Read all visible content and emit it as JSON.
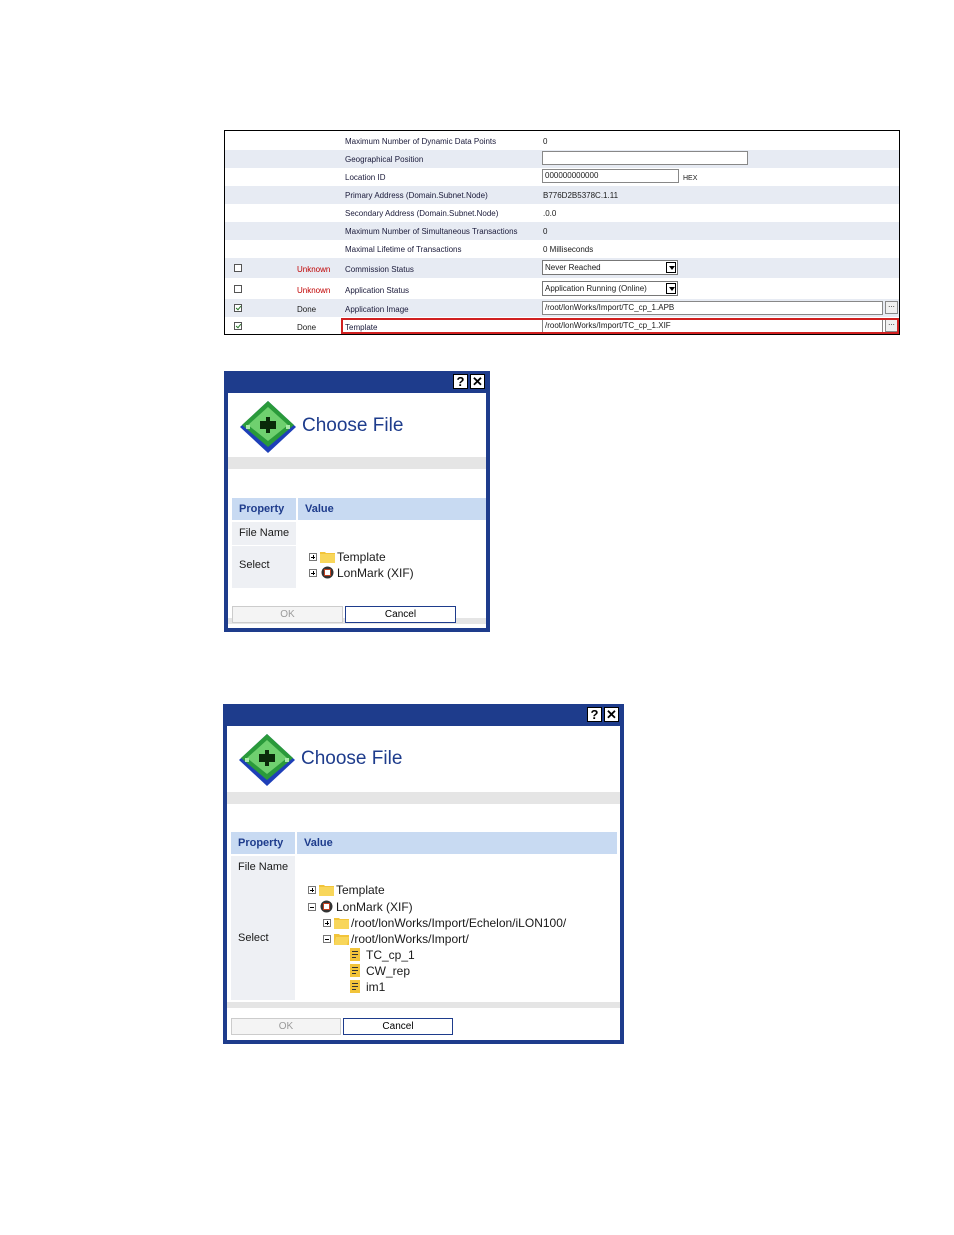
{
  "properties": {
    "rows": [
      {
        "checkbox": null,
        "status": "",
        "name": "Maximum Number of Dynamic Data Points",
        "value": "0"
      },
      {
        "checkbox": null,
        "status": "",
        "name": "Geographical Position",
        "value": ""
      },
      {
        "checkbox": null,
        "status": "",
        "name": "Location ID",
        "value": "000000000000"
      },
      {
        "checkbox": null,
        "status": "",
        "name": "Primary Address (Domain.Subnet.Node)",
        "value": "B776D2B5378C.1.11"
      },
      {
        "checkbox": null,
        "status": "",
        "name": "Secondary Address (Domain.Subnet.Node)",
        "value": ".0.0"
      },
      {
        "checkbox": null,
        "status": "",
        "name": "Maximum Number of Simultaneous Transactions",
        "value": "0"
      },
      {
        "checkbox": null,
        "status": "",
        "name": "Maximal Lifetime of Transactions",
        "value": "0 Milliseconds"
      },
      {
        "checkbox": false,
        "status": "Unknown",
        "name": "Commission Status",
        "value": "Never Reached"
      },
      {
        "checkbox": false,
        "status": "Unknown",
        "name": "Application Status",
        "value": "Application Running (Online)"
      },
      {
        "checkbox": true,
        "status": "Done",
        "name": "Application Image",
        "value": "/root/lonWorks/Import/TC_cp_1.APB"
      },
      {
        "checkbox": true,
        "status": "Done",
        "name": "Template",
        "value": "/root/lonWorks/Import/TC_cp_1.XIF"
      }
    ],
    "hex_label": "HEX",
    "browse_label": "..."
  },
  "dialog1": {
    "help_label": "?",
    "close_label": "✕",
    "title": "Choose File",
    "header": {
      "property": "Property",
      "value": "Value"
    },
    "file_name_label": "File Name",
    "select_label": "Select",
    "tree": [
      {
        "expander": "plus",
        "icon": "folder-icon",
        "label": "Template"
      },
      {
        "expander": "plus",
        "icon": "lonmark-icon",
        "label": "LonMark (XIF)"
      }
    ],
    "ok_label": "OK",
    "cancel_label": "Cancel"
  },
  "dialog2": {
    "help_label": "?",
    "close_label": "✕",
    "title": "Choose File",
    "header": {
      "property": "Property",
      "value": "Value"
    },
    "file_name_label": "File Name",
    "select_label": "Select",
    "tree": [
      {
        "expander": "plus",
        "icon": "folder-icon",
        "label": "Template"
      },
      {
        "expander": "minus",
        "icon": "lonmark-icon",
        "label": "LonMark (XIF)"
      },
      {
        "expander": "plus",
        "icon": "folder-icon",
        "label": "/root/lonWorks/Import/Echelon/iLON100/"
      },
      {
        "expander": "minus",
        "icon": "folder-icon",
        "label": "/root/lonWorks/Import/"
      },
      {
        "expander": null,
        "icon": "file-icon",
        "label": "TC_cp_1"
      },
      {
        "expander": null,
        "icon": "file-icon",
        "label": "CW_rep"
      },
      {
        "expander": null,
        "icon": "file-icon",
        "label": "im1"
      }
    ],
    "ok_label": "OK",
    "cancel_label": "Cancel"
  },
  "colors": {
    "dialog_frame": "#1e3c8c",
    "header_bg": "#c8daf2",
    "highlight": "#d02020",
    "unknown": "#c00000"
  }
}
